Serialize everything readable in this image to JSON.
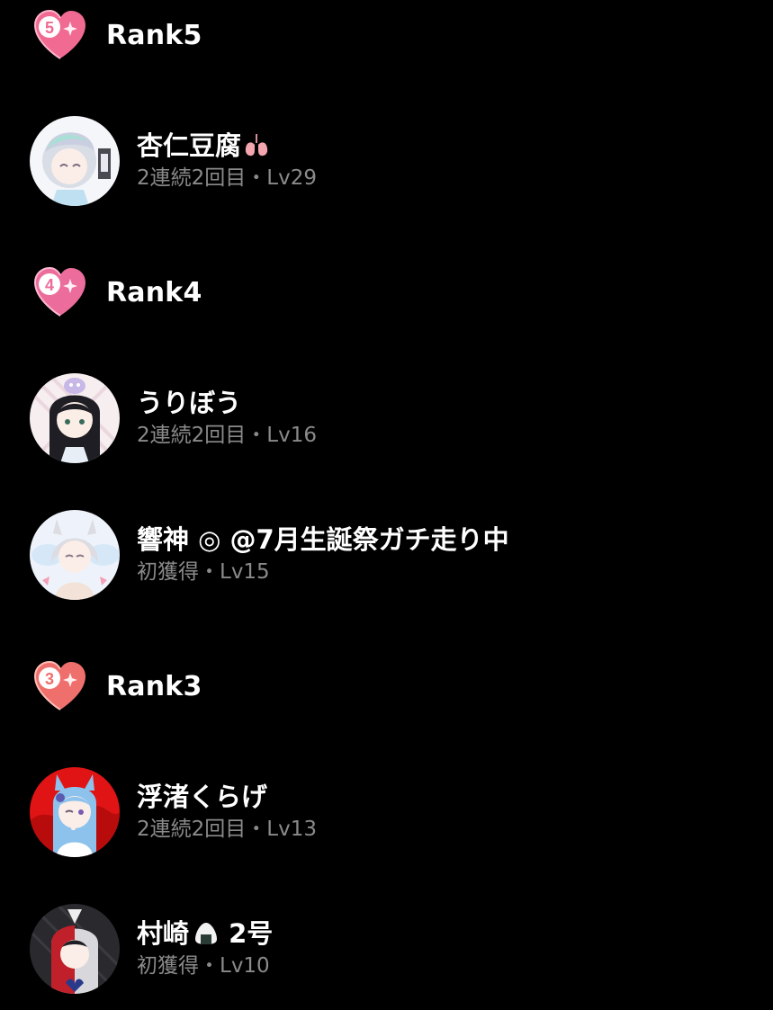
{
  "ranks": [
    {
      "number": "5",
      "title": "Rank5",
      "badge_color": "#f06a92",
      "entries": [
        {
          "name": "杏仁豆腐",
          "name_emoji": "lungs-icon",
          "suffix": "",
          "sub": "2連続2回目・Lv29"
        }
      ]
    },
    {
      "number": "4",
      "title": "Rank4",
      "badge_color": "#ec6d9b",
      "entries": [
        {
          "name": "うりぼう",
          "name_emoji": "",
          "suffix": "",
          "sub": "2連続2回目・Lv16"
        },
        {
          "name": "響神 ◎ @7月生誕祭ガチ走り中",
          "name_emoji": "",
          "suffix": "",
          "sub": "初獲得・Lv15"
        }
      ]
    },
    {
      "number": "3",
      "title": "Rank3",
      "badge_color": "#ef6f6c",
      "entries": [
        {
          "name": "浮渚くらげ",
          "name_emoji": "",
          "suffix": "",
          "sub": "2連続2回目・Lv13"
        },
        {
          "name": "村崎",
          "name_emoji": "rice-ball-icon",
          "suffix": " 2号",
          "sub": "初獲得・Lv10"
        }
      ]
    }
  ]
}
